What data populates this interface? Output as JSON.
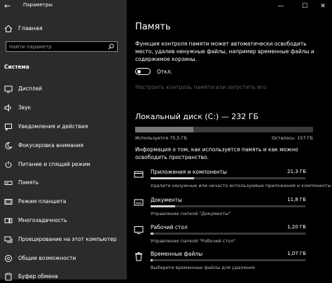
{
  "window": {
    "title": "Параметры",
    "controls": [
      "—",
      "☐",
      "✕"
    ]
  },
  "sidebar": {
    "home": "Главная",
    "search_placeholder": "Найти параметр",
    "section": "Система",
    "items": [
      {
        "label": "Дисплей",
        "icon": "monitor-icon"
      },
      {
        "label": "Звук",
        "icon": "speaker-icon"
      },
      {
        "label": "Уведомления и действия",
        "icon": "notifications-icon"
      },
      {
        "label": "Фокусировка внимания",
        "icon": "moon-icon"
      },
      {
        "label": "Питание и спящий режим",
        "icon": "power-icon"
      },
      {
        "label": "Память",
        "icon": "storage-icon"
      },
      {
        "label": "Режим планшета",
        "icon": "tablet-icon"
      },
      {
        "label": "Многозадачность",
        "icon": "multitasking-icon"
      },
      {
        "label": "Проецирование на этот компьютер",
        "icon": "projection-icon"
      },
      {
        "label": "Общие возможности",
        "icon": "shared-experiences-icon"
      },
      {
        "label": "Буфер обмена",
        "icon": "clipboard-icon"
      }
    ]
  },
  "main": {
    "title": "Память",
    "description": "Функция контроля памяти может автоматически освободить место, удалив ненужные файлы, например временные файлы и содержимое корзины.",
    "toggle_label": "Откл.",
    "storage_sense_link": "Настроить контроль памяти или запустить его",
    "disk_title": "Локальный диск (C:) — 232 ГБ",
    "disk_used_fraction": 0.326,
    "used": "Используется 75,5 ГБ",
    "free": "Осталось: 157 ГБ",
    "info": "Информация о том, как используется память и как можно освободить пространство.",
    "categories": [
      {
        "name": "Приложения и компоненты",
        "size": "21,3 ГБ",
        "sub": "Удалите ненужные или нечасто используемые приложения и компоненты",
        "fraction": 0.28,
        "icon": "apps-icon"
      },
      {
        "name": "Документы",
        "size": "11,8 ГБ",
        "sub": "Управление папкой \"Документы\"",
        "fraction": 0.16,
        "icon": "documents-icon"
      },
      {
        "name": "Рабочий стол",
        "size": "1,20 ГБ",
        "sub": "Управление папкой \"Рабочий стол\"",
        "fraction": 0.02,
        "icon": "desktop-icon"
      },
      {
        "name": "Временные файлы",
        "size": "1,07 ГБ",
        "sub": "Выберите временные файлы для удаления",
        "fraction": 0.015,
        "icon": "trash-icon"
      }
    ]
  }
}
